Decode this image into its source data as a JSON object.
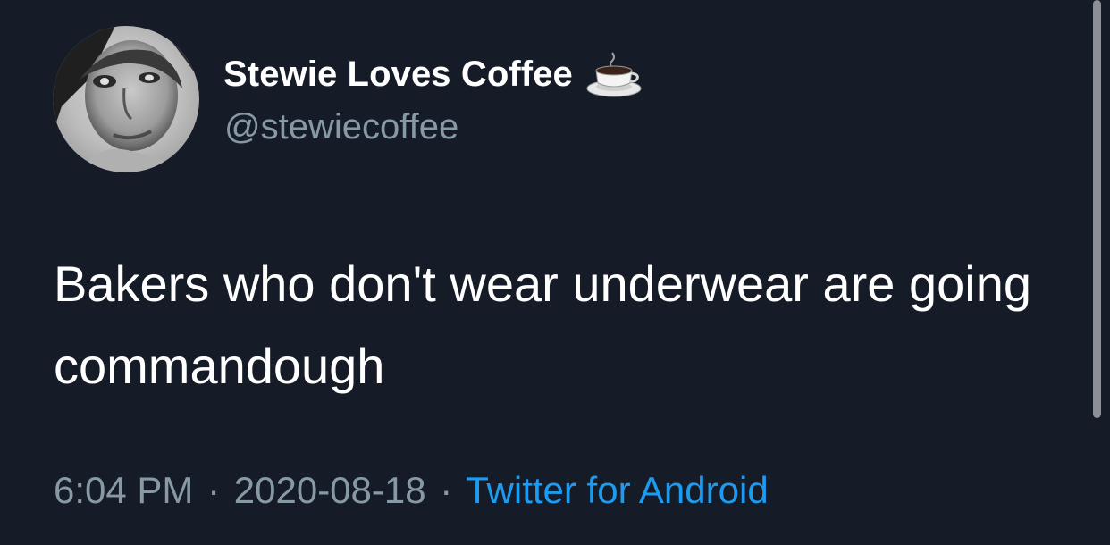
{
  "tweet": {
    "display_name": "Stewie Loves Coffee",
    "emoji_icon": "hot-coffee-icon",
    "handle": "@stewiecoffee",
    "text": "Bakers who don't wear underwear are going commandough",
    "time": "6:04 PM",
    "separator": "·",
    "date": "2020-08-18",
    "source": "Twitter for Android"
  },
  "colors": {
    "background": "#161c27",
    "primary_text": "#ffffff",
    "secondary_text": "#8899a6",
    "link": "#1d9bf0"
  }
}
